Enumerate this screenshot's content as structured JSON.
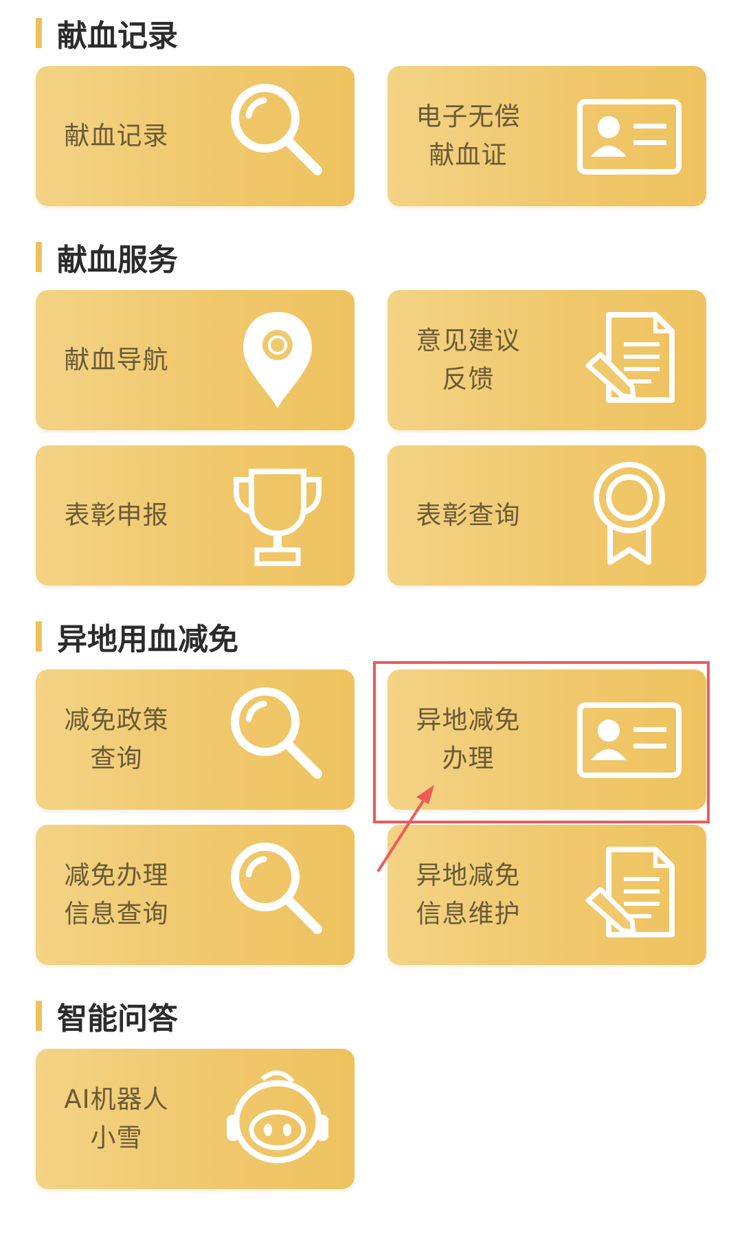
{
  "sections": [
    {
      "title": "献血记录"
    },
    {
      "title": "献血服务"
    },
    {
      "title": "异地用血减免"
    },
    {
      "title": "智能问答"
    }
  ],
  "cards": {
    "record": {
      "line1": "献血记录",
      "line2": "",
      "icon": "search-icon"
    },
    "certificate": {
      "line1": "电子无偿",
      "line2": "献血证",
      "icon": "id-card-icon"
    },
    "navigation": {
      "line1": "献血导航",
      "line2": "",
      "icon": "location-pin-icon"
    },
    "feedback": {
      "line1": "意见建议",
      "line2": "反馈",
      "icon": "document-edit-icon"
    },
    "award_apply": {
      "line1": "表彰申报",
      "line2": "",
      "icon": "trophy-icon"
    },
    "award_query": {
      "line1": "表彰查询",
      "line2": "",
      "icon": "medal-icon"
    },
    "policy_query": {
      "line1": "减免政策",
      "line2": "查询",
      "icon": "search-icon"
    },
    "remote_apply": {
      "line1": "异地减免",
      "line2": "办理",
      "icon": "id-card-icon"
    },
    "apply_query": {
      "line1": "减免办理",
      "line2": "信息查询",
      "icon": "search-icon"
    },
    "info_maintain": {
      "line1": "异地减免",
      "line2": "信息维护",
      "icon": "document-edit-icon"
    },
    "ai_robot": {
      "line1": "AI机器人",
      "line2": "小雪",
      "icon": "robot-icon"
    }
  },
  "colors": {
    "card": "#f0c86d",
    "accent_bar": "#efc15a",
    "highlight": "#ee5a5a",
    "label": "#6a5a36"
  }
}
